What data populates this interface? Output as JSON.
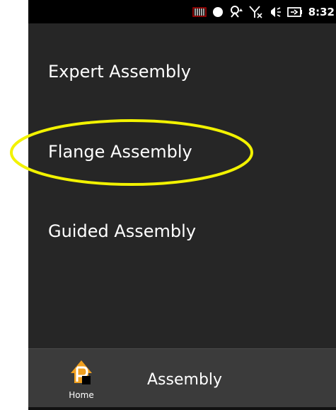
{
  "status_bar": {
    "time": "8:32",
    "icons": [
      "signal-bars-icon",
      "record-dot-icon",
      "sync-icon",
      "no-signal-icon",
      "volume-icon",
      "battery-icon"
    ]
  },
  "menu": {
    "items": [
      {
        "label": "Expert Assembly"
      },
      {
        "label": "Flange Assembly",
        "highlighted": true
      },
      {
        "label": "Guided Assembly"
      }
    ]
  },
  "highlight_color": "#f2f200",
  "bottom_bar": {
    "home_label": "Home",
    "title": "Assembly",
    "home_icon_color": "#f0a020"
  }
}
